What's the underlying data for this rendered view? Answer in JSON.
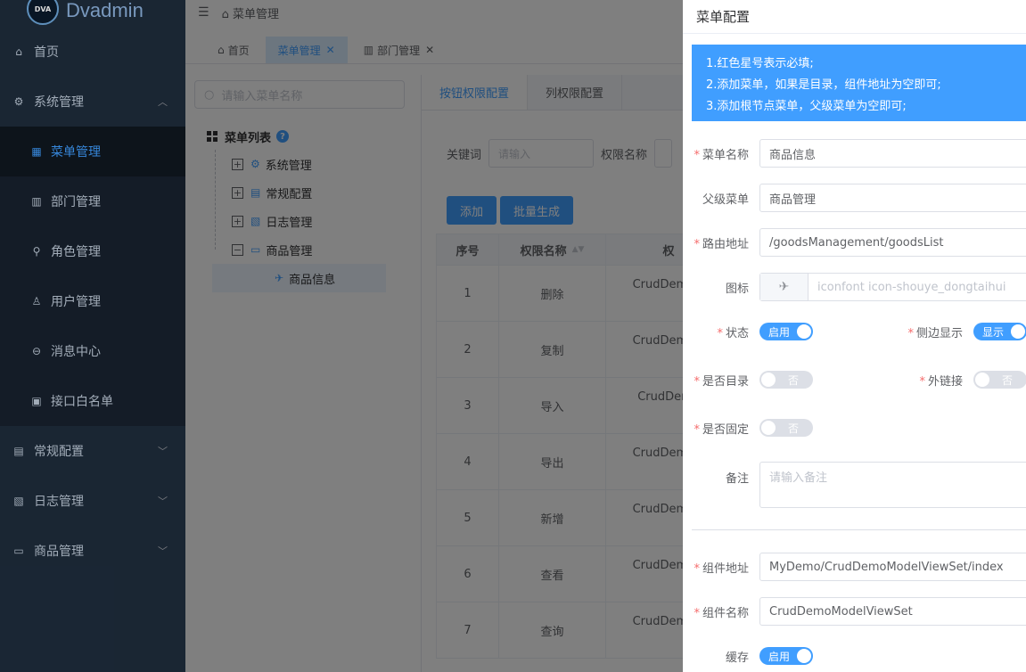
{
  "app": {
    "logo_badge": "DVA",
    "name": "Dvadmin"
  },
  "sidebar": {
    "items": [
      {
        "label": "首页",
        "icon": "home-icon",
        "glyph": "⌂"
      },
      {
        "label": "系统管理",
        "icon": "gear-icon",
        "glyph": "⚙",
        "expanded": true
      },
      {
        "label": "菜单管理",
        "icon": "grid-icon",
        "glyph": "▦",
        "sub": true,
        "active": true
      },
      {
        "label": "部门管理",
        "icon": "building-icon",
        "glyph": "▥",
        "sub": true
      },
      {
        "label": "角色管理",
        "icon": "role-icon",
        "glyph": "⚲",
        "sub": true
      },
      {
        "label": "用户管理",
        "icon": "user-icon",
        "glyph": "♙",
        "sub": true
      },
      {
        "label": "消息中心",
        "icon": "message-icon",
        "glyph": "⊖",
        "sub": true
      },
      {
        "label": "接口白名单",
        "icon": "whitelist-icon",
        "glyph": "▣",
        "sub": true
      },
      {
        "label": "常规配置",
        "icon": "config-icon",
        "glyph": "▤",
        "expandable": true
      },
      {
        "label": "日志管理",
        "icon": "log-icon",
        "glyph": "▧",
        "expandable": true
      },
      {
        "label": "商品管理",
        "icon": "goods-icon",
        "glyph": "▭",
        "expandable": true
      }
    ]
  },
  "breadcrumb": {
    "label": "菜单管理"
  },
  "tabs": [
    {
      "label": "首页",
      "closable": false,
      "icon": "⌂"
    },
    {
      "label": "菜单管理",
      "closable": true,
      "active": true
    },
    {
      "label": "部门管理",
      "closable": true,
      "icon": "▥"
    }
  ],
  "tree": {
    "search_placeholder": "请输入菜单名称",
    "root_label": "菜单列表",
    "nodes": [
      {
        "label": "系统管理",
        "toggle": "+",
        "glyph": "⚙"
      },
      {
        "label": "常规配置",
        "toggle": "+",
        "glyph": "▤"
      },
      {
        "label": "日志管理",
        "toggle": "+",
        "glyph": "▧"
      },
      {
        "label": "商品管理",
        "toggle": "−",
        "glyph": "▭"
      }
    ],
    "child": {
      "label": "商品信息",
      "glyph": "✈"
    }
  },
  "perm": {
    "tab_button": "按钮权限配置",
    "tab_column": "列权限配置",
    "keyword_label": "关键词",
    "keyword_placeholder": "请输入",
    "perm_name_label": "权限名称",
    "add_button": "添加",
    "batch_button": "批量生成",
    "headers": {
      "index": "序号",
      "name": "权限名称",
      "value": "权"
    },
    "rows": [
      {
        "index": "1",
        "name": "删除",
        "value": "CrudDemoM"
      },
      {
        "index": "2",
        "name": "复制",
        "value": "CrudDemoM"
      },
      {
        "index": "3",
        "name": "导入",
        "value": "CrudDemo"
      },
      {
        "index": "4",
        "name": "导出",
        "value": "CrudDemoM"
      },
      {
        "index": "5",
        "name": "新增",
        "value": "CrudDemoM"
      },
      {
        "index": "6",
        "name": "查看",
        "value": "CrudDemoM"
      },
      {
        "index": "7",
        "name": "查询",
        "value": "CrudDemoM"
      }
    ]
  },
  "drawer": {
    "title": "菜单配置",
    "alert_lines": [
      "1.红色星号表示必填;",
      "2.添加菜单，如果是目录，组件地址为空即可;",
      "3.添加根节点菜单，父级菜单为空即可;"
    ],
    "fields": {
      "menu_name": {
        "label": "菜单名称",
        "value": "商品信息"
      },
      "parent": {
        "label": "父级菜单",
        "value": "商品管理"
      },
      "route": {
        "label": "路由地址",
        "value": "/goodsManagement/goodsList"
      },
      "icon": {
        "label": "图标",
        "value": "iconfont icon-shouye_dongtaihui"
      },
      "status": {
        "label": "状态",
        "value": "启用"
      },
      "sidebar_show": {
        "label": "侧边显示",
        "value": "显示"
      },
      "is_catalog": {
        "label": "是否目录",
        "value": "否"
      },
      "external": {
        "label": "外链接",
        "value": "否"
      },
      "is_fixed": {
        "label": "是否固定",
        "value": "否"
      },
      "remark": {
        "label": "备注",
        "placeholder": "请输入备注"
      },
      "component": {
        "label": "组件地址",
        "value": "MyDemo/CrudDemoModelViewSet/index"
      },
      "component_name": {
        "label": "组件名称",
        "value": "CrudDemoModelViewSet"
      },
      "cache": {
        "label": "缓存",
        "value": "启用"
      }
    }
  }
}
